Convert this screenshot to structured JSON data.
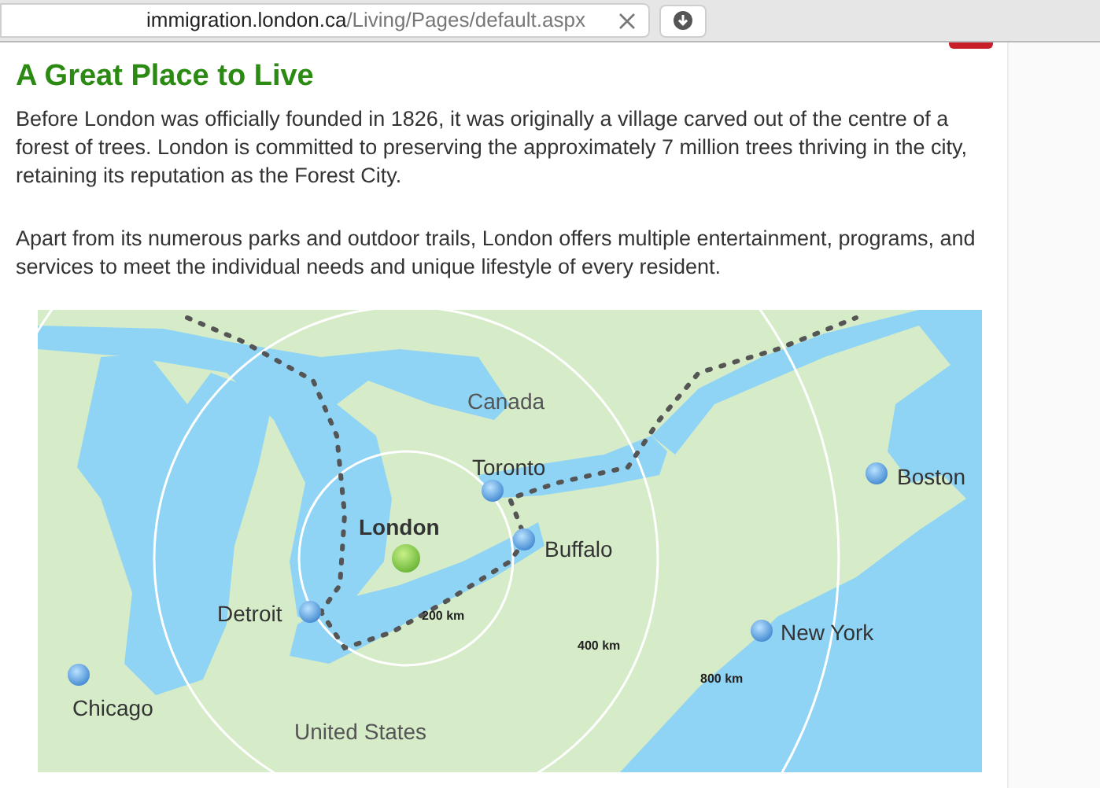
{
  "address_bar": {
    "host": "immigration.london.ca",
    "path": "/Living/Pages/default.aspx"
  },
  "article": {
    "title": "A Great Place to Live",
    "paragraphs": [
      "Before London was officially founded in 1826, it was originally a village carved out of the centre of a forest of trees. London is committed to preserving the approximately 7 million trees thriving in the city, retaining its reputation as the Forest City.",
      "Apart from its numerous parks and outdoor trails, London offers multiple entertainment, programs, and services to meet the individual needs and unique lifestyle of every resident."
    ]
  },
  "map": {
    "regions": [
      "Canada",
      "United States"
    ],
    "cities": [
      {
        "name": "Toronto",
        "kind": "city"
      },
      {
        "name": "Boston",
        "kind": "city"
      },
      {
        "name": "London",
        "kind": "home"
      },
      {
        "name": "Buffalo",
        "kind": "city"
      },
      {
        "name": "Detroit",
        "kind": "city"
      },
      {
        "name": "New York",
        "kind": "city"
      },
      {
        "name": "Chicago",
        "kind": "city"
      }
    ],
    "distances": [
      "200 km",
      "400 km",
      "800 km"
    ]
  }
}
